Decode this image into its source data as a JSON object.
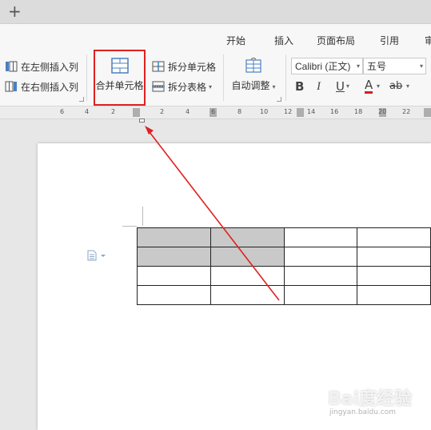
{
  "tabbar": {
    "new_tab": "+"
  },
  "menu": [
    "开始",
    "插入",
    "页面布局",
    "引用",
    "审"
  ],
  "ribbon": {
    "insert_left_col": "在左侧插入列",
    "insert_right_col": "在右侧插入列",
    "merge_cells": "合并单元格",
    "split_cells": "拆分单元格",
    "split_table": "拆分表格",
    "auto_fit": "自动调整",
    "font_name": "Calibri (正文)",
    "font_size": "五号"
  },
  "format": {
    "bold": "B",
    "italic": "I",
    "underline": "U",
    "font_color": "A",
    "highlight": "ab"
  },
  "ruler": {
    "labels": [
      "6",
      "4",
      "2",
      "2",
      "4",
      "6",
      "8",
      "10",
      "12",
      "14",
      "16",
      "18",
      "20",
      "22"
    ]
  },
  "table": {
    "rows": [
      [
        true,
        true,
        false,
        false
      ],
      [
        true,
        true,
        false,
        false
      ],
      [
        false,
        false,
        false,
        false
      ],
      [
        false,
        false,
        false,
        false
      ]
    ]
  },
  "watermark": {
    "main": "Bai度经验",
    "sub": "jingyan.baidu.com"
  },
  "colors": {
    "highlight_box": "#e02020",
    "arrow": "#e02020",
    "selected_cell": "#c9c9c9",
    "font_color_bar": "#d42020"
  }
}
